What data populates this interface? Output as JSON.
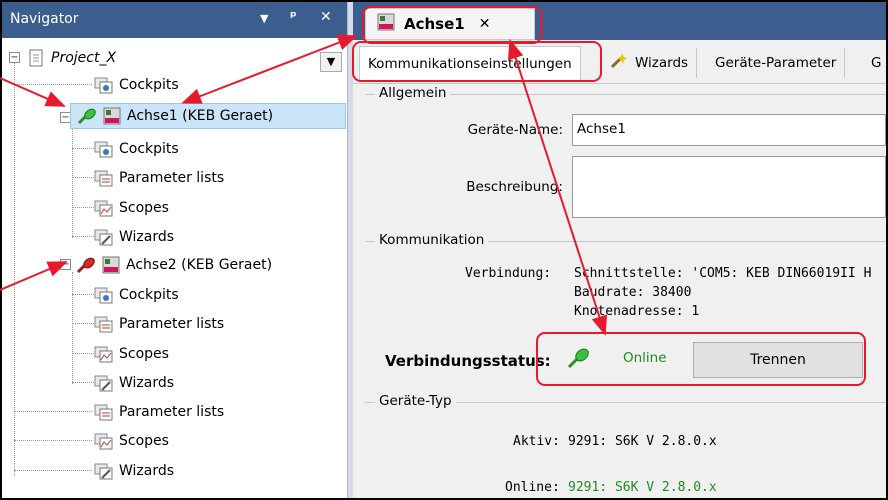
{
  "navigator": {
    "title": "Navigator",
    "pin_glyph": "▼",
    "dock_glyph": "ᵖ",
    "close_glyph": "✕",
    "dropdown_glyph": "▼",
    "tree": {
      "project": "Project_X",
      "project_cockpits": "Cockpits",
      "achse1": "Achse1 (KEB Geraet)",
      "achse1_cockpits": "Cockpits",
      "achse1_parameter_lists": "Parameter lists",
      "achse1_scopes": "Scopes",
      "achse1_wizards": "Wizards",
      "achse2": "Achse2 (KEB Geraet)",
      "achse2_cockpits": "Cockpits",
      "achse2_parameter_lists": "Parameter lists",
      "achse2_scopes": "Scopes",
      "achse2_wizards": "Wizards",
      "parameter_lists": "Parameter lists",
      "scopes": "Scopes",
      "wizards": "Wizards"
    }
  },
  "document_tab": {
    "label": "Achse1",
    "close": "✕"
  },
  "sub_tabs": {
    "kommunikation": "Kommunikationseinstellungen",
    "wizards": "Wizards",
    "geraete_parameter": "Geräte-Parameter",
    "more": "G"
  },
  "allgemein": {
    "title": "Allgemein",
    "geraete_name_label": "Geräte-Name:",
    "geraete_name_value": "Achse1",
    "beschreibung_label": "Beschreibung:",
    "beschreibung_value": ""
  },
  "kommunikation": {
    "title": "Kommunikation",
    "verbindung_label": "Verbindung:",
    "line1": "Schnittstelle: 'COM5: KEB DIN66019II H",
    "line2": "Baudrate: 38400",
    "line3": "Knotenadresse: 1",
    "status_label": "Verbindungsstatus:",
    "status_value": "Online",
    "trennen": "Trennen"
  },
  "geraete_typ": {
    "title": "Geräte-Typ",
    "aktiv_label": "Aktiv:",
    "aktiv_value": "9291: S6K V 2.8.0.x",
    "online_label": "Online:",
    "online_value": "9291: S6K V 2.8.0.x"
  },
  "colors": {
    "header_blue": "#3c5e8f",
    "online_green": "#1e8c1e",
    "highlight_red": "#e8192c",
    "selection_blue": "#cce4f7"
  }
}
